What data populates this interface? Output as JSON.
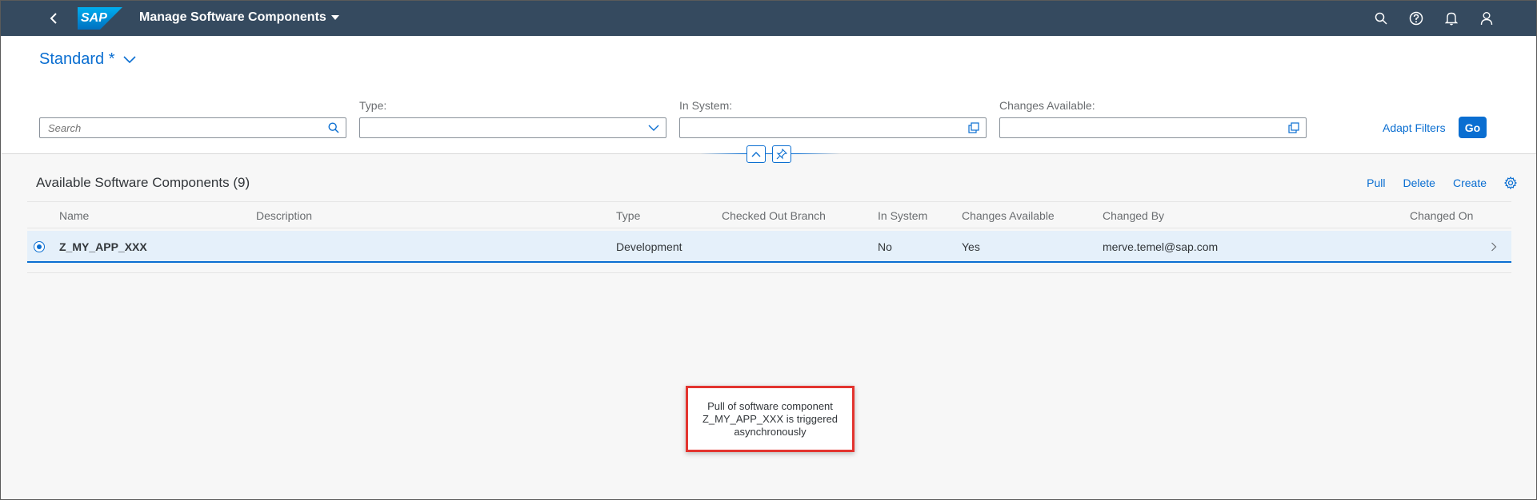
{
  "shell": {
    "logo_text": "SAP",
    "app_title": "Manage Software Components"
  },
  "filters": {
    "variant": "Standard *",
    "search_placeholder": "Search",
    "type_label": "Type:",
    "in_system_label": "In System:",
    "changes_available_label": "Changes Available:",
    "adapt_filters": "Adapt Filters",
    "go": "Go"
  },
  "table": {
    "title": "Available Software Components (9)",
    "actions": {
      "pull": "Pull",
      "delete": "Delete",
      "create": "Create"
    },
    "columns": [
      "Name",
      "Description",
      "Type",
      "Checked Out Branch",
      "In System",
      "Changes Available",
      "Changed By",
      "Changed On"
    ],
    "rows": [
      {
        "name": "Z_MY_APP_XXX",
        "description": "",
        "type": "Development",
        "checked_out_branch": "",
        "in_system": "No",
        "changes_available": "Yes",
        "changed_by": "merve.temel@sap.com",
        "changed_on": ""
      }
    ]
  },
  "toast": {
    "message": "Pull of software component Z_MY_APP_XXX is triggered asynchronously"
  },
  "colors": {
    "shell": "#354a5f",
    "accent": "#0a6ed1",
    "selected_row": "#e5f0fa",
    "highlight_border": "#e3342f"
  }
}
